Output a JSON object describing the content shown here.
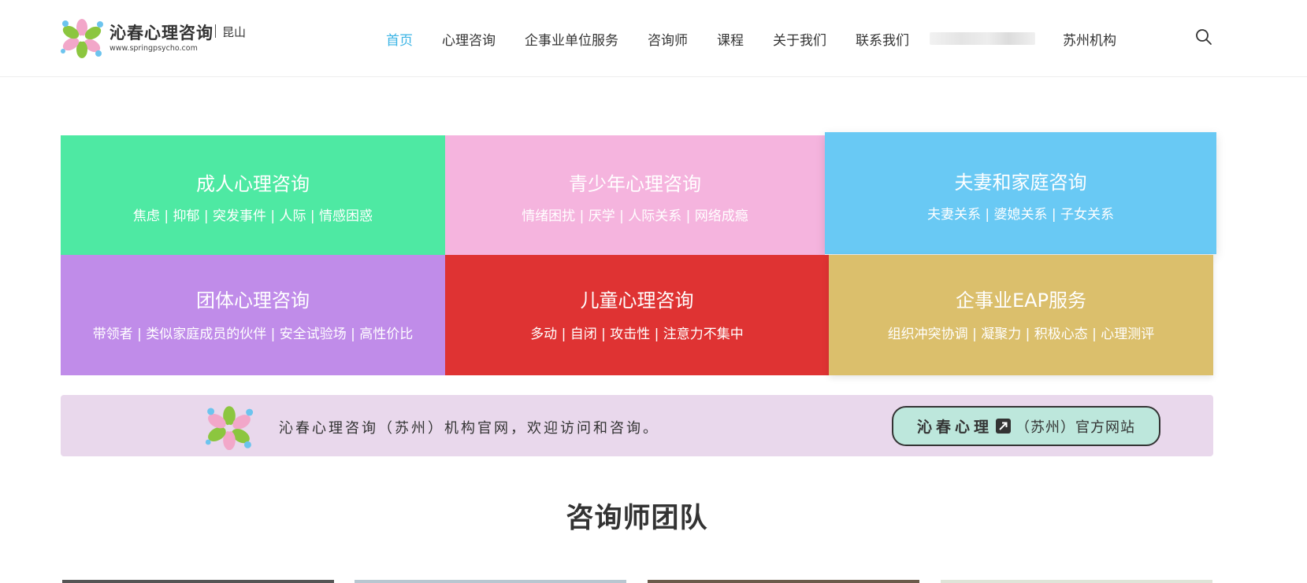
{
  "brand": {
    "name": "沁春心理咨询",
    "city": "昆山",
    "url": "www.springpsycho.com",
    "petal_colors": [
      "#f2a7c9",
      "#8cc63f",
      "#6cc4ee"
    ]
  },
  "nav": {
    "items": [
      {
        "label": "首页",
        "active": true
      },
      {
        "label": "心理咨询"
      },
      {
        "label": "企事业单位服务"
      },
      {
        "label": "咨询师"
      },
      {
        "label": "课程"
      },
      {
        "label": "关于我们"
      },
      {
        "label": "联系我们"
      },
      {
        "label": "苏州机构"
      }
    ],
    "active_color": "#3bb4e5",
    "search_icon": "search-icon"
  },
  "tiles": [
    {
      "title": "成人心理咨询",
      "sub": "焦虑 | 抑郁 | 突发事件 | 人际 | 情感困惑",
      "color": "#4ee9a3"
    },
    {
      "title": "青少年心理咨询",
      "sub": "情绪困扰 | 厌学 | 人际关系 | 网络成瘾",
      "color": "#f5b4de"
    },
    {
      "title": "夫妻和家庭咨询",
      "sub": "夫妻关系 | 婆媳关系 | 子女关系",
      "color": "#69c9f4"
    },
    {
      "title": "团体心理咨询",
      "sub": "带领者 | 类似家庭成员的伙伴 | 安全试验场 | 高性价比",
      "color": "#c08ce9"
    },
    {
      "title": "儿童心理咨询",
      "sub": "多动 | 自闭 | 攻击性 | 注意力不集中",
      "color": "#df3333"
    },
    {
      "title": "企事业EAP服务",
      "sub": "组织冲突协调 | 凝聚力 | 积极心态 | 心理测评",
      "color": "#dbbf6c"
    }
  ],
  "banner": {
    "text": "沁春心理咨询（苏州）机构官网，欢迎访问和咨询。",
    "button_brand": "沁春心理",
    "button_suffix": "（苏州）官方网站",
    "button_icon": "external-link-icon",
    "background": "#e9d8ec",
    "button_color": "#bde7dc"
  },
  "team": {
    "title": "咨询师团队"
  }
}
